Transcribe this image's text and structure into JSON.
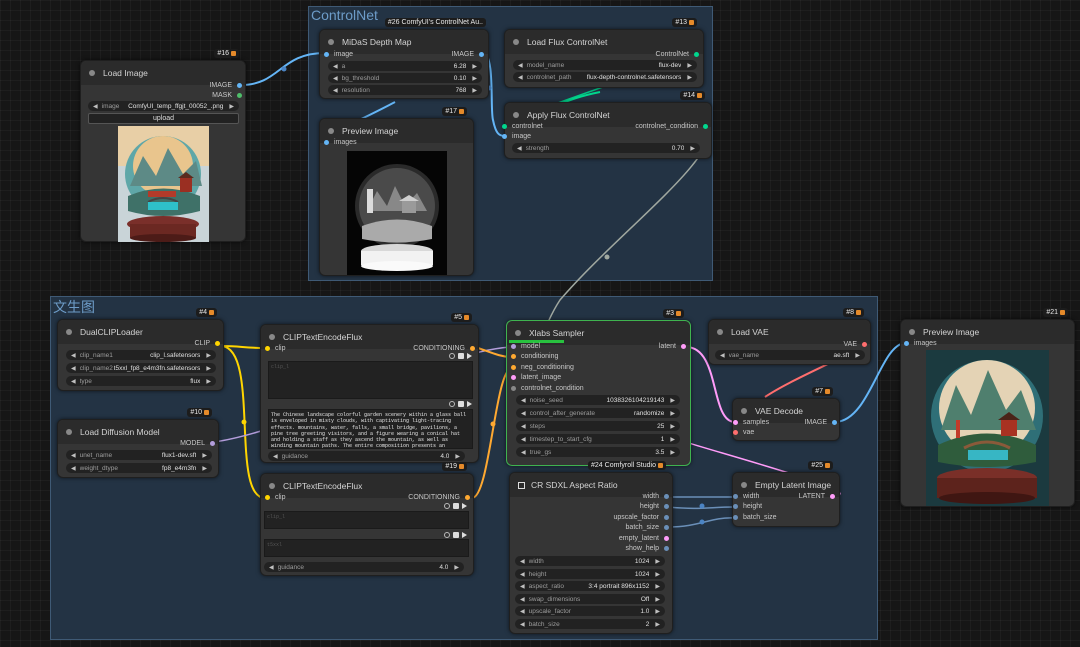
{
  "groups": {
    "controlnet": "ControlNet",
    "txt2img": "文生图"
  },
  "colors": {
    "canvas": "#161616",
    "group_fill": "#233344",
    "node_fill": "#353535",
    "image_link": "#64b5f6",
    "latent_link": "#ff9cf9",
    "conditioning_link": "#ffa931",
    "clip_link": "#ffd500",
    "model_link": "#b39ddb",
    "vae_link": "#ff6e6e",
    "controlnet_link": "#00d78d",
    "selected_border": "#3fb34f"
  },
  "load_image": {
    "badge": "#16",
    "title": "Load Image",
    "outputs": [
      "IMAGE",
      "MASK"
    ],
    "image_label": "image",
    "image_value": "ComfyUI_temp_ffgjt_00052_.png",
    "upload_label": "upload"
  },
  "midas": {
    "badge": "#26 ComfyUI's ControlNet Au..",
    "title": "MiDaS Depth Map",
    "input": "image",
    "output": "IMAGE",
    "widgets": [
      {
        "label": "a",
        "value": "6.28"
      },
      {
        "label": "bg_threshold",
        "value": "0.10"
      },
      {
        "label": "resolution",
        "value": "768"
      }
    ]
  },
  "preview_depth": {
    "badge": "#17",
    "title": "Preview Image",
    "input": "images"
  },
  "load_flux_cn": {
    "badge": "#13",
    "title": "Load Flux ControlNet",
    "output": "ControlNet",
    "widgets": [
      {
        "label": "model_name",
        "value": "flux-dev"
      },
      {
        "label": "controlnet_path",
        "value": "flux-depth-controlnet.safetensors"
      }
    ]
  },
  "apply_flux_cn": {
    "badge": "#14",
    "title": "Apply Flux ControlNet",
    "inputs": [
      "controlnet",
      "image"
    ],
    "output": "controlnet_condition",
    "widgets": [
      {
        "label": "strength",
        "value": "0.70"
      }
    ]
  },
  "dual_clip": {
    "badge": "#4",
    "title": "DualCLIPLoader",
    "output": "CLIP",
    "widgets": [
      {
        "label": "clip_name1",
        "value": "clip_l.safetensors"
      },
      {
        "label": "clip_name2",
        "value": "t5xxl_fp8_e4m3fn.safetensors"
      },
      {
        "label": "type",
        "value": "flux"
      }
    ]
  },
  "load_diffusion": {
    "badge": "#10",
    "title": "Load Diffusion Model",
    "output": "MODEL",
    "widgets": [
      {
        "label": "unet_name",
        "value": "flux1-dev.sft"
      },
      {
        "label": "weight_dtype",
        "value": "fp8_e4m3fn"
      }
    ]
  },
  "clip_pos": {
    "badge": "#5",
    "title": "CLIPTextEncodeFlux",
    "input": "clip",
    "output": "CONDITIONING",
    "placeholder1": "clip_l",
    "prompt": "The Chinese landscape colorful garden scenery within a glass ball is enveloped in misty clouds, with captivating light-tracing effects. mountains, water, falls, a small bridge, pavilions, a pine tree greeting visitors, and a figure wearing a conical hat and holding a staff as they ascend the mountain, as well as winding mountain paths. The entire composition presents an exquisite level of detail and aesthetic appeal.",
    "guidance_label": "guidance",
    "guidance_value": "4.0"
  },
  "clip_neg": {
    "badge": "#19",
    "title": "CLIPTextEncodeFlux",
    "input": "clip",
    "output": "CONDITIONING",
    "placeholder1": "clip_l",
    "placeholder2": "t5xxl",
    "guidance_label": "guidance",
    "guidance_value": "4.0"
  },
  "xlabs": {
    "badge": "#3",
    "title": "Xlabs Sampler",
    "inputs": [
      "model",
      "conditioning",
      "neg_conditioning",
      "latent_image",
      "controlnet_condition"
    ],
    "output": "latent",
    "widgets": [
      {
        "label": "noise_seed",
        "value": "1038326104219143"
      },
      {
        "label": "control_after_generate",
        "value": "randomize"
      },
      {
        "label": "steps",
        "value": "25"
      },
      {
        "label": "timestep_to_start_cfg",
        "value": "1"
      },
      {
        "label": "true_gs",
        "value": "3.5"
      }
    ]
  },
  "aspect": {
    "badge": "#24 Comfyroll Studio",
    "title": "CR SDXL Aspect Ratio",
    "outputs": [
      "width",
      "height",
      "upscale_factor",
      "batch_size",
      "empty_latent",
      "show_help"
    ],
    "widgets": [
      {
        "label": "width",
        "value": "1024"
      },
      {
        "label": "height",
        "value": "1024"
      },
      {
        "label": "aspect_ratio",
        "value": "3:4 portrait 896x1152"
      },
      {
        "label": "swap_dimensions",
        "value": "Off"
      },
      {
        "label": "upscale_factor",
        "value": "1.0"
      },
      {
        "label": "batch_size",
        "value": "2"
      }
    ]
  },
  "load_vae": {
    "badge": "#8",
    "title": "Load VAE",
    "output": "VAE",
    "widgets": [
      {
        "label": "vae_name",
        "value": "ae.sft"
      }
    ]
  },
  "vae_decode": {
    "badge": "#7",
    "title": "VAE Decode",
    "inputs": [
      "samples",
      "vae"
    ],
    "output": "IMAGE"
  },
  "empty_latent": {
    "badge": "#25",
    "title": "Empty Latent Image",
    "inputs": [
      "width",
      "height",
      "batch_size"
    ],
    "output": "LATENT"
  },
  "preview_final": {
    "badge": "#21",
    "title": "Preview Image",
    "input": "images"
  }
}
